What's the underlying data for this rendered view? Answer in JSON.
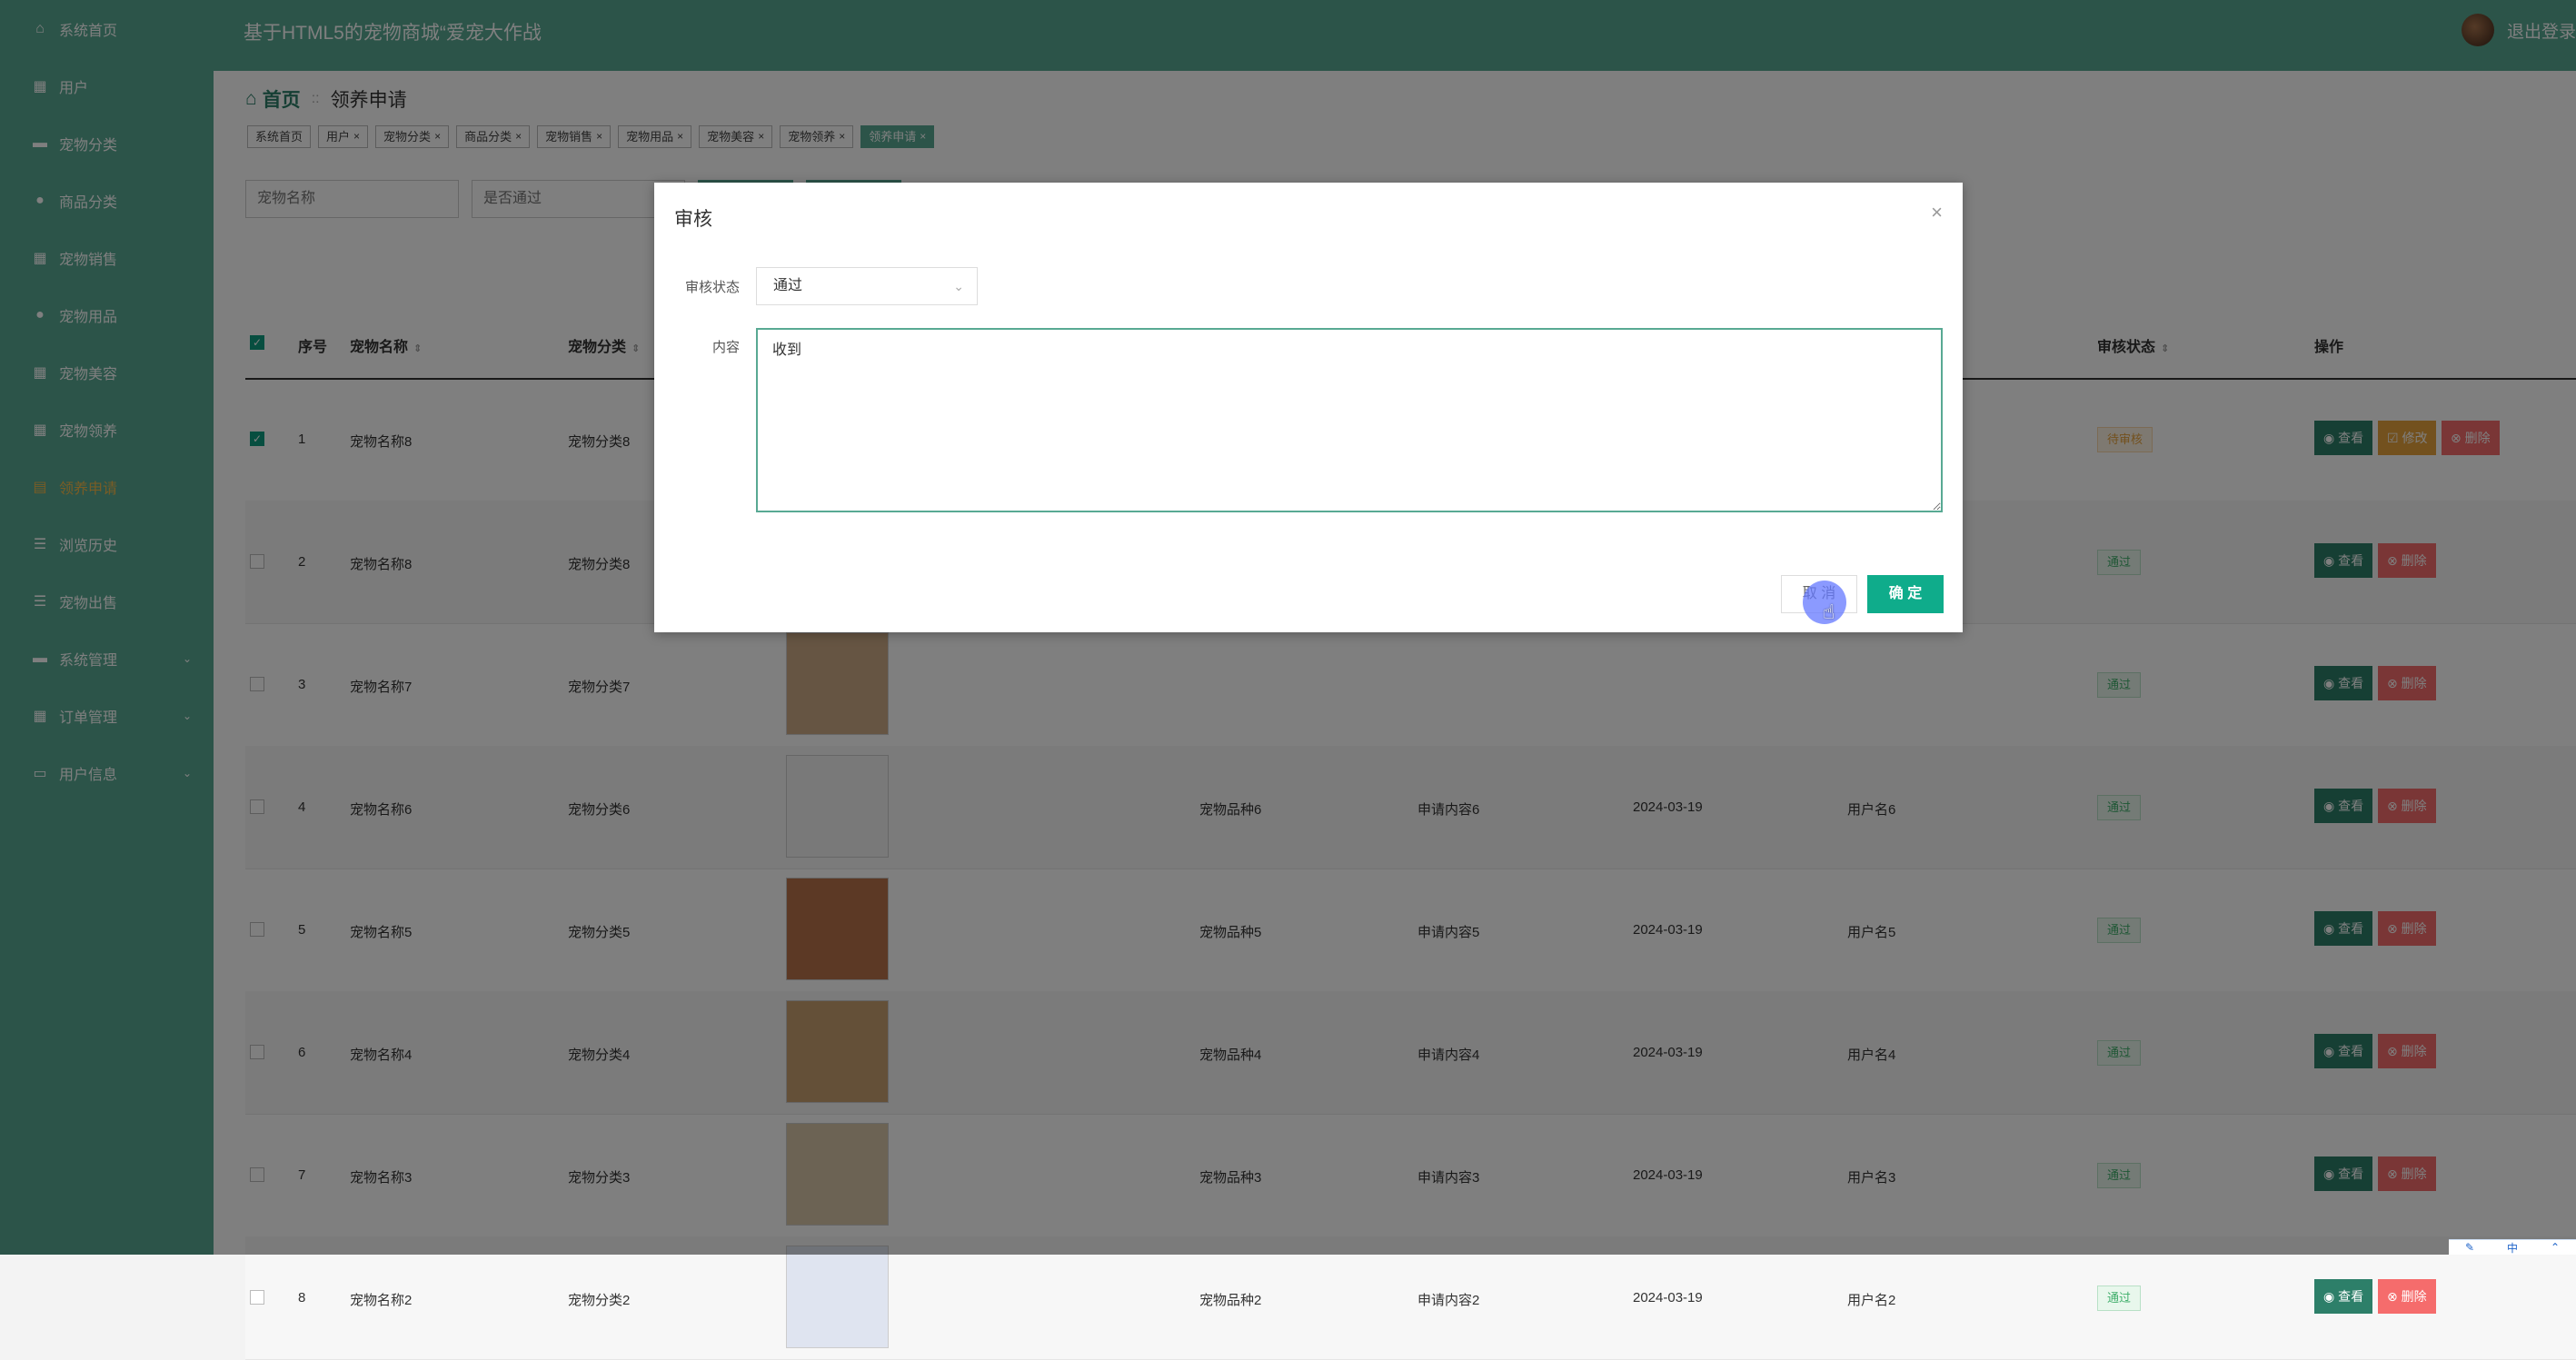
{
  "app_title": "基于HTML5的宠物商城“爱宠大作战",
  "logout_label": "退出登录",
  "sidebar": {
    "items": [
      {
        "label": "系统首页",
        "icon": "home-icon",
        "glyph": "⌂"
      },
      {
        "label": "用户",
        "icon": "grid-icon",
        "glyph": "▦"
      },
      {
        "label": "宠物分类",
        "icon": "briefcase-icon",
        "glyph": "▬"
      },
      {
        "label": "商品分类",
        "icon": "user-icon",
        "glyph": "●"
      },
      {
        "label": "宠物销售",
        "icon": "grid-icon",
        "glyph": "▦"
      },
      {
        "label": "宠物用品",
        "icon": "location-icon",
        "glyph": "●"
      },
      {
        "label": "宠物美容",
        "icon": "grid-icon",
        "glyph": "▦"
      },
      {
        "label": "宠物领养",
        "icon": "table-icon",
        "glyph": "▦"
      },
      {
        "label": "领养申请",
        "icon": "clipboard-icon",
        "glyph": "▤"
      },
      {
        "label": "浏览历史",
        "icon": "list-icon",
        "glyph": "☰"
      },
      {
        "label": "宠物出售",
        "icon": "sliders-icon",
        "glyph": "☰"
      },
      {
        "label": "系统管理",
        "icon": "tools-icon",
        "glyph": "▬",
        "caret": "⌄"
      },
      {
        "label": "订单管理",
        "icon": "grid-icon",
        "glyph": "▦",
        "caret": "⌄"
      },
      {
        "label": "用户信息",
        "icon": "id-card-icon",
        "glyph": "▭",
        "caret": "⌄"
      }
    ]
  },
  "breadcrumb": {
    "home": "首页",
    "sep": "::",
    "current": "领养申请"
  },
  "tags": [
    {
      "label": "系统首页",
      "close": ""
    },
    {
      "label": "用户",
      "close": "×"
    },
    {
      "label": "宠物分类",
      "close": "×"
    },
    {
      "label": "商品分类",
      "close": "×"
    },
    {
      "label": "宠物销售",
      "close": "×"
    },
    {
      "label": "宠物用品",
      "close": "×"
    },
    {
      "label": "宠物美容",
      "close": "×"
    },
    {
      "label": "宠物领养",
      "close": "×"
    },
    {
      "label": "领养申请",
      "close": "×"
    }
  ],
  "search": {
    "name_placeholder": "宠物名称",
    "pass_placeholder": "是否通过"
  },
  "table": {
    "headers": {
      "index": "序号",
      "name": "宠物名称",
      "category": "宠物分类",
      "status": "审核状态",
      "ops": "操作"
    },
    "sort_glyph": "⇕",
    "rows": [
      {
        "idx": "1",
        "name": "宠物名称8",
        "cat": "宠物分类8",
        "breed": "",
        "content": "",
        "date": "",
        "user": "",
        "status": "待审核",
        "pending": true,
        "checked": true
      },
      {
        "idx": "2",
        "name": "宠物名称8",
        "cat": "宠物分类8",
        "breed": "",
        "content": "",
        "date": "",
        "user": "",
        "status": "通过",
        "pending": false,
        "checked": false
      },
      {
        "idx": "3",
        "name": "宠物名称7",
        "cat": "宠物分类7",
        "breed": "",
        "content": "",
        "date": "",
        "user": "",
        "status": "通过",
        "pending": false,
        "checked": false
      },
      {
        "idx": "4",
        "name": "宠物名称6",
        "cat": "宠物分类6",
        "breed": "宠物品种6",
        "content": "申请内容6",
        "date": "2024-03-19",
        "user": "用户名6",
        "status": "通过",
        "pending": false,
        "checked": false
      },
      {
        "idx": "5",
        "name": "宠物名称5",
        "cat": "宠物分类5",
        "breed": "宠物品种5",
        "content": "申请内容5",
        "date": "2024-03-19",
        "user": "用户名5",
        "status": "通过",
        "pending": false,
        "checked": false
      },
      {
        "idx": "6",
        "name": "宠物名称4",
        "cat": "宠物分类4",
        "breed": "宠物品种4",
        "content": "申请内容4",
        "date": "2024-03-19",
        "user": "用户名4",
        "status": "通过",
        "pending": false,
        "checked": false
      },
      {
        "idx": "7",
        "name": "宠物名称3",
        "cat": "宠物分类3",
        "breed": "宠物品种3",
        "content": "申请内容3",
        "date": "2024-03-19",
        "user": "用户名3",
        "status": "通过",
        "pending": false,
        "checked": false
      },
      {
        "idx": "8",
        "name": "宠物名称2",
        "cat": "宠物分类2",
        "breed": "宠物品种2",
        "content": "申请内容2",
        "date": "2024-03-19",
        "user": "用户名2",
        "status": "通过",
        "pending": false,
        "checked": false
      }
    ],
    "actions": {
      "view": "◉ 查看",
      "edit": "☑ 修改",
      "delete": "⊗ 删除"
    }
  },
  "dialog": {
    "title": "审核",
    "close_glyph": "×",
    "status_label": "审核状态",
    "status_value": "通过",
    "status_chevron": "⌄",
    "content_label": "内容",
    "content_value": "收到",
    "cancel_label": "取 消",
    "ok_label": "确 定"
  },
  "colors": {
    "primary": "#58a993",
    "dark_green": "#2d7f69",
    "warning": "#e6a23c",
    "danger": "#f56c6c",
    "confirm": "#0fac8b"
  }
}
